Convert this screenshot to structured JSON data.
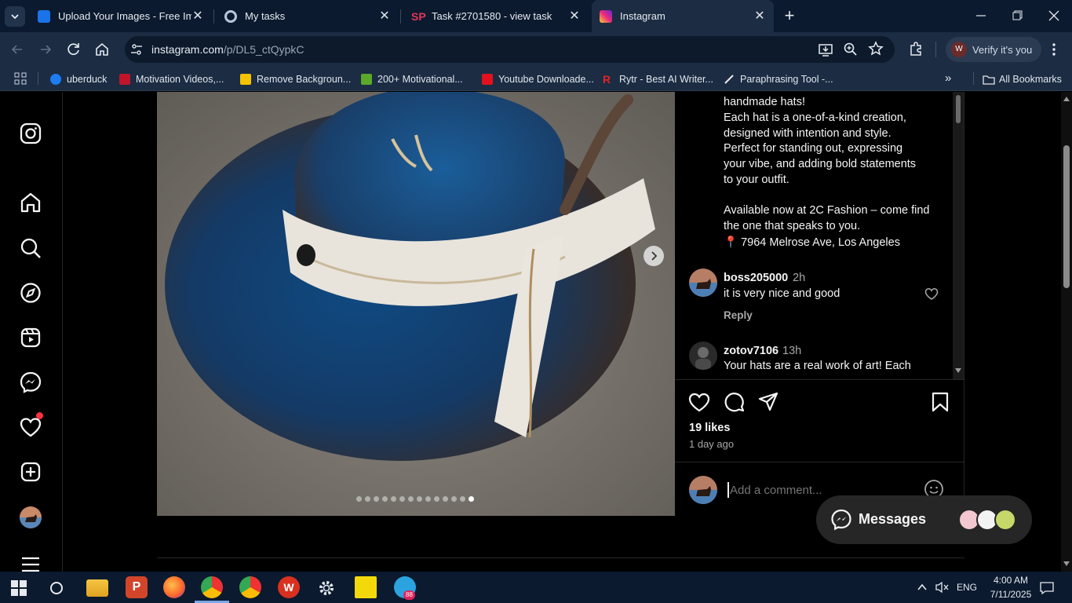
{
  "browser": {
    "tabs": [
      {
        "title": "Upload Your Images - Free Ima",
        "icon": "image-upload-favicon-icon",
        "active": false
      },
      {
        "title": "My tasks",
        "icon": "tasks-favicon-icon",
        "active": false
      },
      {
        "title": "Task #2701580 - view task",
        "icon": "sp-favicon-icon",
        "active": false
      },
      {
        "title": "Instagram",
        "icon": "instagram-favicon-icon",
        "active": true
      }
    ],
    "new_tab_symbol": "+",
    "url_host": "instagram.com",
    "url_path": "/p/DL5_ctQypkC",
    "profile_label": "Verify it's you",
    "profile_initial": "W",
    "bookmarks": [
      {
        "label": "uberduck",
        "icon": "uberduck-icon",
        "color": "#1e7bf2"
      },
      {
        "label": "Motivation Videos,...",
        "icon": "motivation-icon",
        "color": "#c0142b"
      },
      {
        "label": "Remove Backgroun...",
        "icon": "remove-bg-icon",
        "color": "#f3c300"
      },
      {
        "label": "200+ Motivational...",
        "icon": "shopify-icon",
        "color": "#5ba82b"
      },
      {
        "label": "Youtube Downloade...",
        "icon": "youtube-download-icon",
        "color": "#e3101d"
      },
      {
        "label": "Rytr - Best AI Writer...",
        "icon": "rytr-icon",
        "color": "#e02323"
      },
      {
        "label": "Paraphrasing Tool -...",
        "icon": "paraphrasing-icon",
        "color": "#eaeaea"
      }
    ],
    "all_bookmarks_label": "All Bookmarks"
  },
  "post": {
    "caption_lines": [
      "handmade hats!",
      "Each hat is a one-of-a-kind creation,",
      "designed with intention and style.",
      "Perfect for standing out, expressing",
      "your vibe, and adding bold statements",
      "to your outfit.",
      "",
      "Available now at 2C Fashion – come find",
      "the one that speaks to you.",
      "📍 7964 Melrose Ave, Los Angeles"
    ],
    "comments": [
      {
        "user": "boss205000",
        "time": "2h",
        "text": "it is very nice and good",
        "reply_label": "Reply"
      },
      {
        "user": "zotov7106",
        "time": "13h",
        "text": "Your hats are a real work of art! Each",
        "reply_label": ""
      }
    ],
    "likes": "19 likes",
    "posted": "1 day ago",
    "comment_placeholder": "Add a comment...",
    "carousel_dots": 14
  },
  "messages_label": "Messages",
  "taskbar": {
    "time": "4:00 AM",
    "date": "7/11/2025",
    "language": "ENG",
    "telegram_badge": "88"
  },
  "colors": {
    "chrome_dark": "#0b1a2e",
    "chrome_toolbar": "#1b2c43",
    "instagram_bg": "#000000",
    "notification_red": "#ff3040"
  }
}
